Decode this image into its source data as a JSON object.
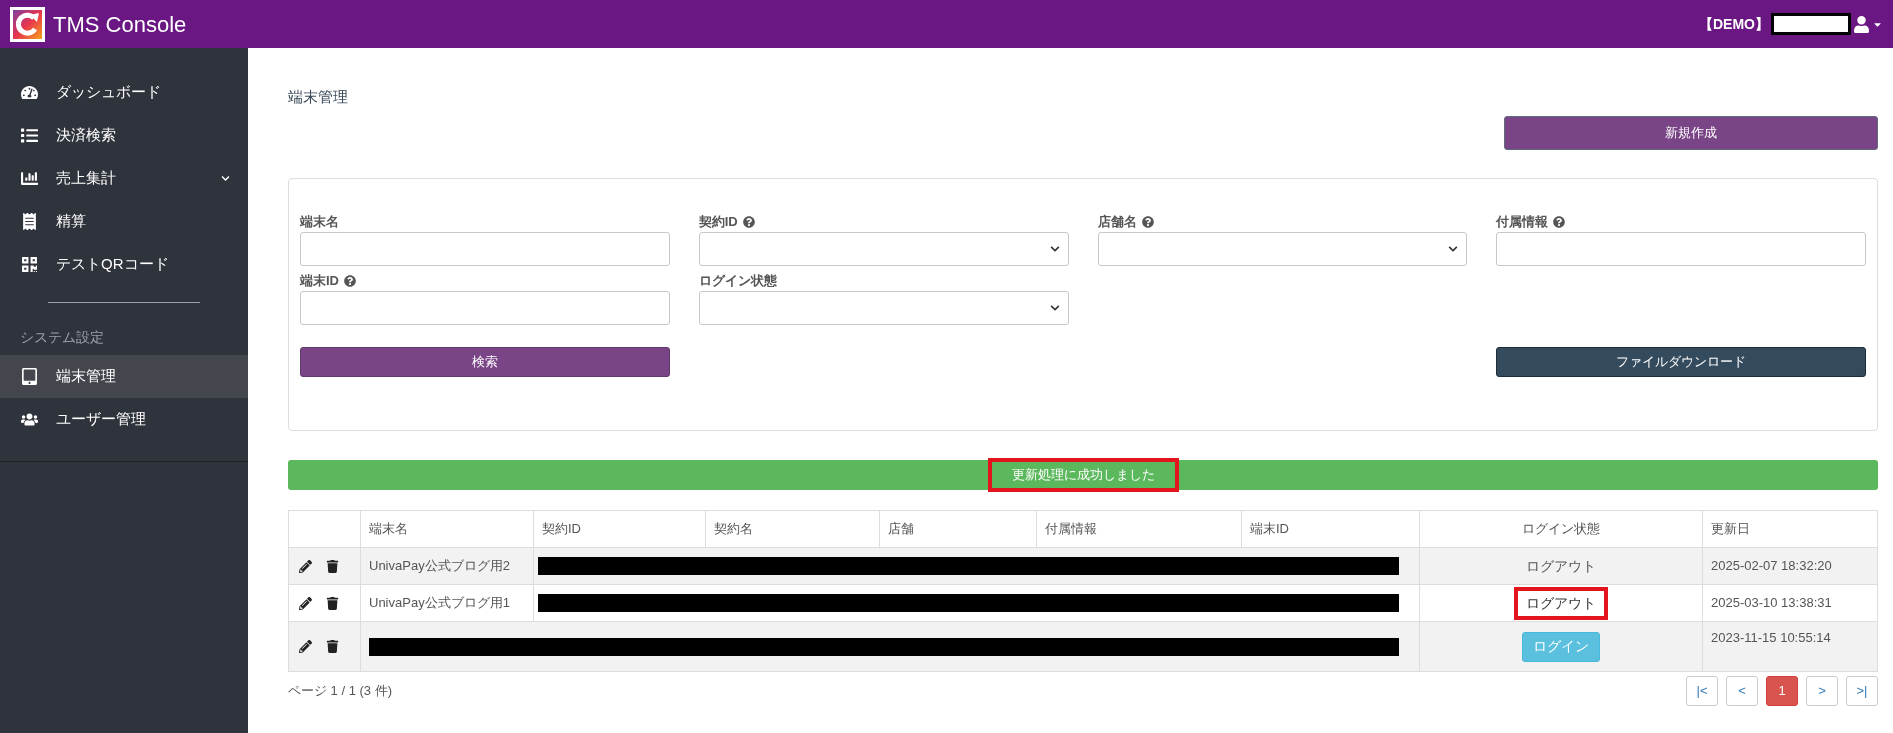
{
  "header": {
    "title": "TMS Console",
    "environment": "【DEMO】"
  },
  "sidebar": {
    "items": [
      {
        "label": "ダッシュボード",
        "selected": false,
        "expandable": false
      },
      {
        "label": "決済検索",
        "selected": false,
        "expandable": false
      },
      {
        "label": "売上集計",
        "selected": false,
        "expandable": true
      },
      {
        "label": "精算",
        "selected": false,
        "expandable": false
      },
      {
        "label": "テストQRコード",
        "selected": false,
        "expandable": false
      }
    ],
    "section_label": "システム設定",
    "section_items": [
      {
        "label": "端末管理",
        "selected": true,
        "expandable": false
      },
      {
        "label": "ユーザー管理",
        "selected": false,
        "expandable": false
      }
    ]
  },
  "page_title": "端末管理",
  "new_button": "新規作成",
  "filters": [
    {
      "label": "端末名",
      "kind": "text",
      "help": false
    },
    {
      "label": "契約ID",
      "kind": "select",
      "help": true
    },
    {
      "label": "店舗名",
      "kind": "select",
      "help": true
    },
    {
      "label": "付属情報",
      "kind": "text",
      "help": true
    },
    {
      "label": "端末ID",
      "kind": "text",
      "help": true
    },
    {
      "label": "ログイン状態",
      "kind": "select",
      "help": false
    }
  ],
  "search_button": "検索",
  "download_button": "ファイルダウンロード",
  "alert": {
    "message": "更新処理に成功しました",
    "highlighted": true
  },
  "table": {
    "columns": [
      "端末名",
      "契約ID",
      "契約名",
      "店舗",
      "付属情報",
      "端末ID",
      "ログイン状態",
      "更新日"
    ],
    "rows": [
      {
        "name": "UnivaPay公式ブログ用2",
        "name_redacted": false,
        "status": {
          "kind": "text",
          "label": "ログアウト",
          "highlighted": false
        },
        "updated": "2025-02-07 18:32:20"
      },
      {
        "name": "UnivaPay公式ブログ用1",
        "name_redacted": false,
        "status": {
          "kind": "text",
          "label": "ログアウト",
          "highlighted": true
        },
        "updated": "2025-03-10 13:38:31"
      },
      {
        "name_redacted": true,
        "status": {
          "kind": "button",
          "label": "ログイン",
          "highlighted": false
        },
        "updated": "2023-11-15 10:55:14"
      }
    ]
  },
  "pager": {
    "summary": "ページ 1 / 1 (3 件)",
    "buttons": [
      {
        "label": "|<",
        "selected": false
      },
      {
        "label": "<",
        "selected": false
      },
      {
        "label": "1",
        "selected": true
      },
      {
        "label": ">",
        "selected": false
      },
      {
        "label": ">|",
        "selected": false
      }
    ]
  }
}
